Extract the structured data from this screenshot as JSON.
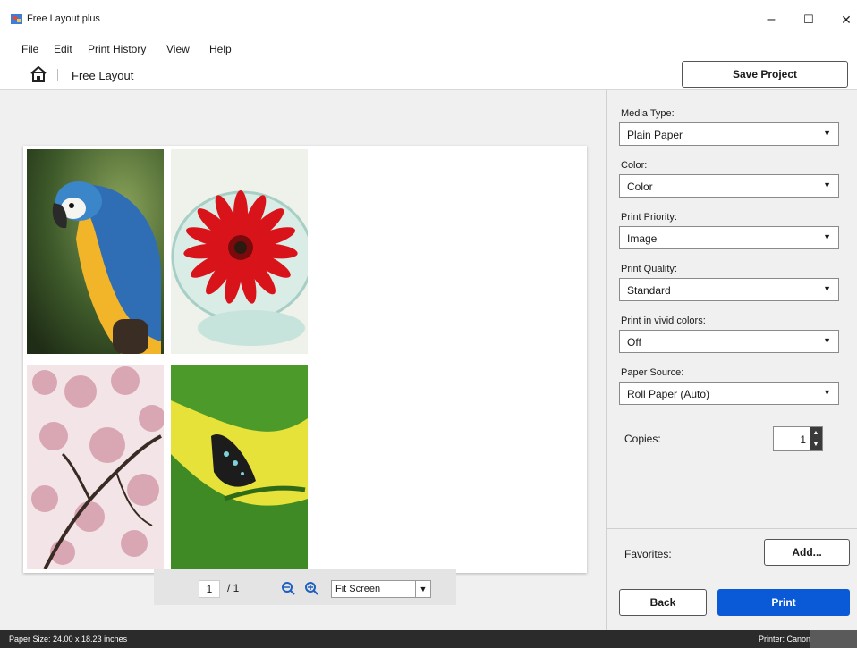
{
  "window": {
    "title": "Free Layout plus",
    "minimize_glyph": "–",
    "maximize_glyph": "☐",
    "close_glyph": "✕"
  },
  "menu": [
    "File",
    "Edit",
    "Print History",
    "View",
    "Help"
  ],
  "breadcrumb": {
    "home_icon": "home-icon",
    "label": "Free Layout"
  },
  "toolbar": {
    "save_label": "Save Project"
  },
  "preview": {
    "photos": [
      "parrot",
      "red-flower",
      "cherry-blossoms",
      "butterfly"
    ],
    "page_current": "1",
    "page_total": "/ 1",
    "zoom_value": "Fit Screen"
  },
  "settings": {
    "media_type": {
      "label": "Media Type:",
      "value": "Plain Paper"
    },
    "color": {
      "label": "Color:",
      "value": "Color"
    },
    "print_priority": {
      "label": "Print Priority:",
      "value": "Image"
    },
    "print_quality": {
      "label": "Print Quality:",
      "value": "Standard"
    },
    "vivid": {
      "label": "Print in vivid colors:",
      "value": "Off"
    },
    "paper_source": {
      "label": "Paper Source:",
      "value": "Roll Paper (Auto)"
    },
    "copies": {
      "label": "Copies:",
      "value": "1"
    }
  },
  "favorites": {
    "label": "Favorites:",
    "add_label": "Add..."
  },
  "actions": {
    "back_label": "Back",
    "print_label": "Print"
  },
  "status": {
    "paper_size": "Paper Size: 24.00 x 18.23 inches",
    "printer": "Printer: Canon"
  },
  "colors": {
    "accent": "#0a5ad8",
    "statusbar": "#2b2b2b"
  }
}
